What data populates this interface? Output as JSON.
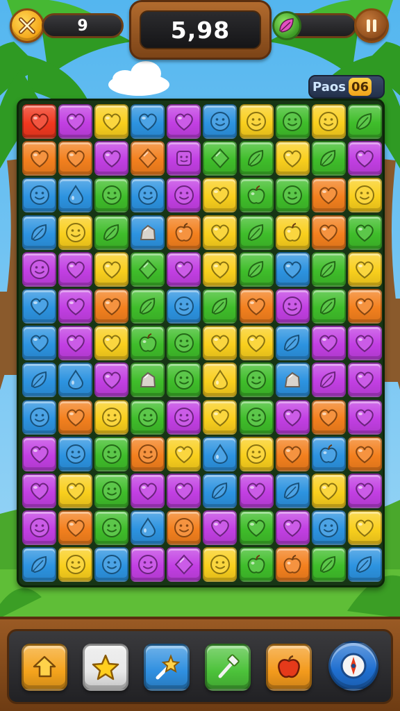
{
  "hud": {
    "moves": "9",
    "score": "5,98",
    "pass_label": "Paos",
    "pass_count": "06",
    "icons": {
      "close": "close-x-icon",
      "pause": "pause-icon",
      "leaf": "leaf-icon"
    }
  },
  "board": {
    "rows": [
      [
        "r-heart",
        "m-heart",
        "y-heart",
        "b-heart",
        "m-heart",
        "b-face",
        "y-face",
        "g-face",
        "y-face",
        "g-leaf"
      ],
      [
        "o-heart",
        "o-heart",
        "m-heart",
        "o-diamond",
        "m-square",
        "g-diamond",
        "g-leaf",
        "y-heart",
        "g-leaf",
        "m-heart"
      ],
      [
        "b-face",
        "b-drop",
        "g-face",
        "b-face",
        "m-face",
        "y-heart",
        "g-apple",
        "g-face",
        "o-heart",
        "y-face"
      ],
      [
        "b-leaf",
        "y-face",
        "g-leaf",
        "b-rock",
        "o-apple",
        "y-heart",
        "g-leaf",
        "y-apple",
        "o-heart",
        "g-heart"
      ],
      [
        "m-face",
        "m-heart",
        "y-heart",
        "g-diamond",
        "m-heart",
        "y-heart",
        "g-leaf",
        "b-heart",
        "g-leaf",
        "y-heart"
      ],
      [
        "b-heart",
        "m-heart",
        "o-heart",
        "g-leaf",
        "b-face",
        "g-leaf",
        "o-heart",
        "m-face",
        "g-leaf",
        "o-heart"
      ],
      [
        "b-heart",
        "m-heart",
        "y-heart",
        "g-apple",
        "g-face",
        "y-heart",
        "y-heart",
        "b-leaf",
        "m-heart",
        "m-heart"
      ],
      [
        "b-leaf",
        "b-drop",
        "m-heart",
        "g-rock",
        "g-face",
        "y-drop",
        "g-face",
        "b-rock",
        "m-leaf",
        "m-heart"
      ],
      [
        "b-face",
        "o-heart",
        "y-face",
        "g-face",
        "m-face",
        "y-heart",
        "g-face",
        "m-heart",
        "o-heart",
        "m-heart"
      ],
      [
        "m-heart",
        "b-face",
        "g-face",
        "o-face",
        "y-heart",
        "b-drop",
        "y-face",
        "o-heart",
        "b-apple",
        "o-heart"
      ],
      [
        "m-heart",
        "y-heart",
        "g-face",
        "m-heart",
        "m-heart",
        "b-leaf",
        "m-heart",
        "b-leaf",
        "y-heart",
        "m-heart"
      ],
      [
        "m-face",
        "o-heart",
        "g-face",
        "b-drop",
        "o-face",
        "m-heart",
        "g-heart",
        "m-heart",
        "b-face",
        "y-heart"
      ],
      [
        "b-leaf",
        "y-face",
        "b-face",
        "m-face",
        "m-diamond",
        "y-face",
        "g-apple",
        "o-apple",
        "g-leaf",
        "b-leaf"
      ]
    ]
  },
  "boosters": [
    {
      "name": "arrow-booster",
      "icon": "arrow-icon",
      "color": "#f5a31c"
    },
    {
      "name": "star-booster",
      "icon": "star-icon",
      "color": "#e8e8e8"
    },
    {
      "name": "magic-wand-booster",
      "icon": "star-wand-icon",
      "color": "#2f8fe0"
    },
    {
      "name": "hammer-booster",
      "icon": "hammer-icon",
      "color": "#4cc23a"
    },
    {
      "name": "apple-booster",
      "icon": "apple-icon",
      "color": "#f39a1c"
    },
    {
      "name": "shuffle-booster",
      "icon": "compass-icon",
      "color": "#1f6fd0"
    }
  ],
  "colors": {
    "r": "#f0381f",
    "o": "#f3801e",
    "y": "#f9cf1d",
    "g": "#3fbd2a",
    "b": "#2c93e0",
    "m": "#c23fe3"
  }
}
